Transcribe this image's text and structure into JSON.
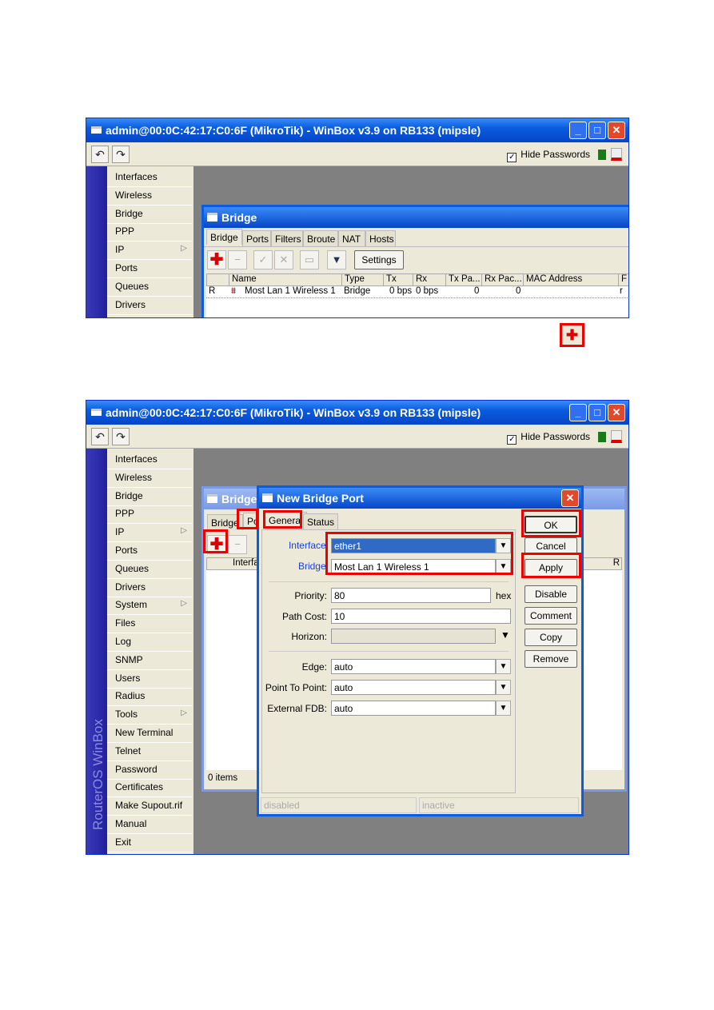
{
  "window": {
    "title": "admin@00:0C:42:17:C0:6F (MikroTik) - WinBox v3.9 on RB133 (mipsle)",
    "hide_passwords": "Hide Passwords",
    "hide_passwords_checked": true,
    "sidebar_brand": "RouterOS WinBox"
  },
  "menu1": [
    "Interfaces",
    "Wireless",
    "Bridge",
    "PPP",
    "IP",
    "Ports",
    "Queues",
    "Drivers"
  ],
  "menu2": [
    "Interfaces",
    "Wireless",
    "Bridge",
    "PPP",
    "IP",
    "Ports",
    "Queues",
    "Drivers",
    "System",
    "Files",
    "Log",
    "SNMP",
    "Users",
    "Radius",
    "Tools",
    "New Terminal",
    "Telnet",
    "Password",
    "Certificates",
    "Make Supout.rif",
    "Manual",
    "Exit"
  ],
  "bridge": {
    "title": "Bridge",
    "tabs": [
      "Bridge",
      "Ports",
      "Filters",
      "Broute",
      "NAT",
      "Hosts"
    ],
    "settings": "Settings",
    "columns": [
      "Name",
      "Type",
      "Tx",
      "Rx",
      "Tx Pa...",
      "Rx Pac...",
      "MAC Address",
      "F"
    ],
    "row": {
      "flag": "R",
      "name": "Most Lan 1 Wireless 1",
      "type": "Bridge",
      "tx": "0 bps",
      "rx": "0 bps",
      "txp": "0",
      "rxp": "0",
      "mac": "",
      "f": "r"
    }
  },
  "bridge2": {
    "title": "Bridge",
    "tab1": "Bridge",
    "tab2": "Po",
    "col": "Interfa",
    "col_r": "R",
    "items": "0 items"
  },
  "dialog": {
    "title": "New Bridge Port",
    "tabs": [
      "General",
      "Status"
    ],
    "fields": {
      "interface_label": "Interface:",
      "interface": "ether1",
      "bridge_label": "Bridge:",
      "bridge": "Most Lan 1 Wireless 1",
      "priority_label": "Priority:",
      "priority": "80",
      "priority_unit": "hex",
      "path_cost_label": "Path Cost:",
      "path_cost": "10",
      "horizon_label": "Horizon:",
      "horizon": "",
      "edge_label": "Edge:",
      "edge": "auto",
      "ptp_label": "Point To Point:",
      "ptp": "auto",
      "fdb_label": "External FDB:",
      "fdb": "auto"
    },
    "buttons": [
      "OK",
      "Cancel",
      "Apply",
      "Disable",
      "Comment",
      "Copy",
      "Remove"
    ],
    "status": [
      "disabled",
      "inactive"
    ]
  },
  "colors": {
    "highlight": "#e00000",
    "title_blue": "#0a5ce0",
    "label_blue": "#1b3fe0"
  }
}
